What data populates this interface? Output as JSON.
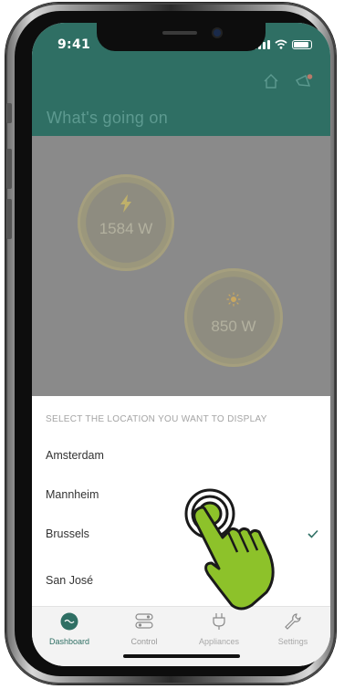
{
  "status_bar": {
    "time": "9:41"
  },
  "header": {
    "title": "What's going on",
    "icons": [
      "home-icon",
      "speaker-alert-icon"
    ]
  },
  "gauges": [
    {
      "value": "1584 W",
      "icon": "lightning-icon"
    },
    {
      "value": "850 W",
      "icon": "sun-icon"
    }
  ],
  "sheet": {
    "title": "SELECT THE LOCATION YOU WANT TO DISPLAY",
    "locations": [
      {
        "label": "Amsterdam",
        "selected": false
      },
      {
        "label": "Mannheim",
        "selected": false
      },
      {
        "label": "Brussels",
        "selected": true
      },
      {
        "label": "San José",
        "selected": false
      }
    ]
  },
  "tabs": [
    {
      "label": "Dashboard",
      "icon": "wave-icon",
      "active": true
    },
    {
      "label": "Control",
      "icon": "toggle-icon",
      "active": false
    },
    {
      "label": "Appliances",
      "icon": "plug-icon",
      "active": false
    },
    {
      "label": "Settings",
      "icon": "wrench-icon",
      "active": false
    }
  ],
  "colors": {
    "brand": "#2f6f64",
    "active_tab": "#2f6f64",
    "check": "#2f6f64",
    "hand": "#8dc22a"
  }
}
